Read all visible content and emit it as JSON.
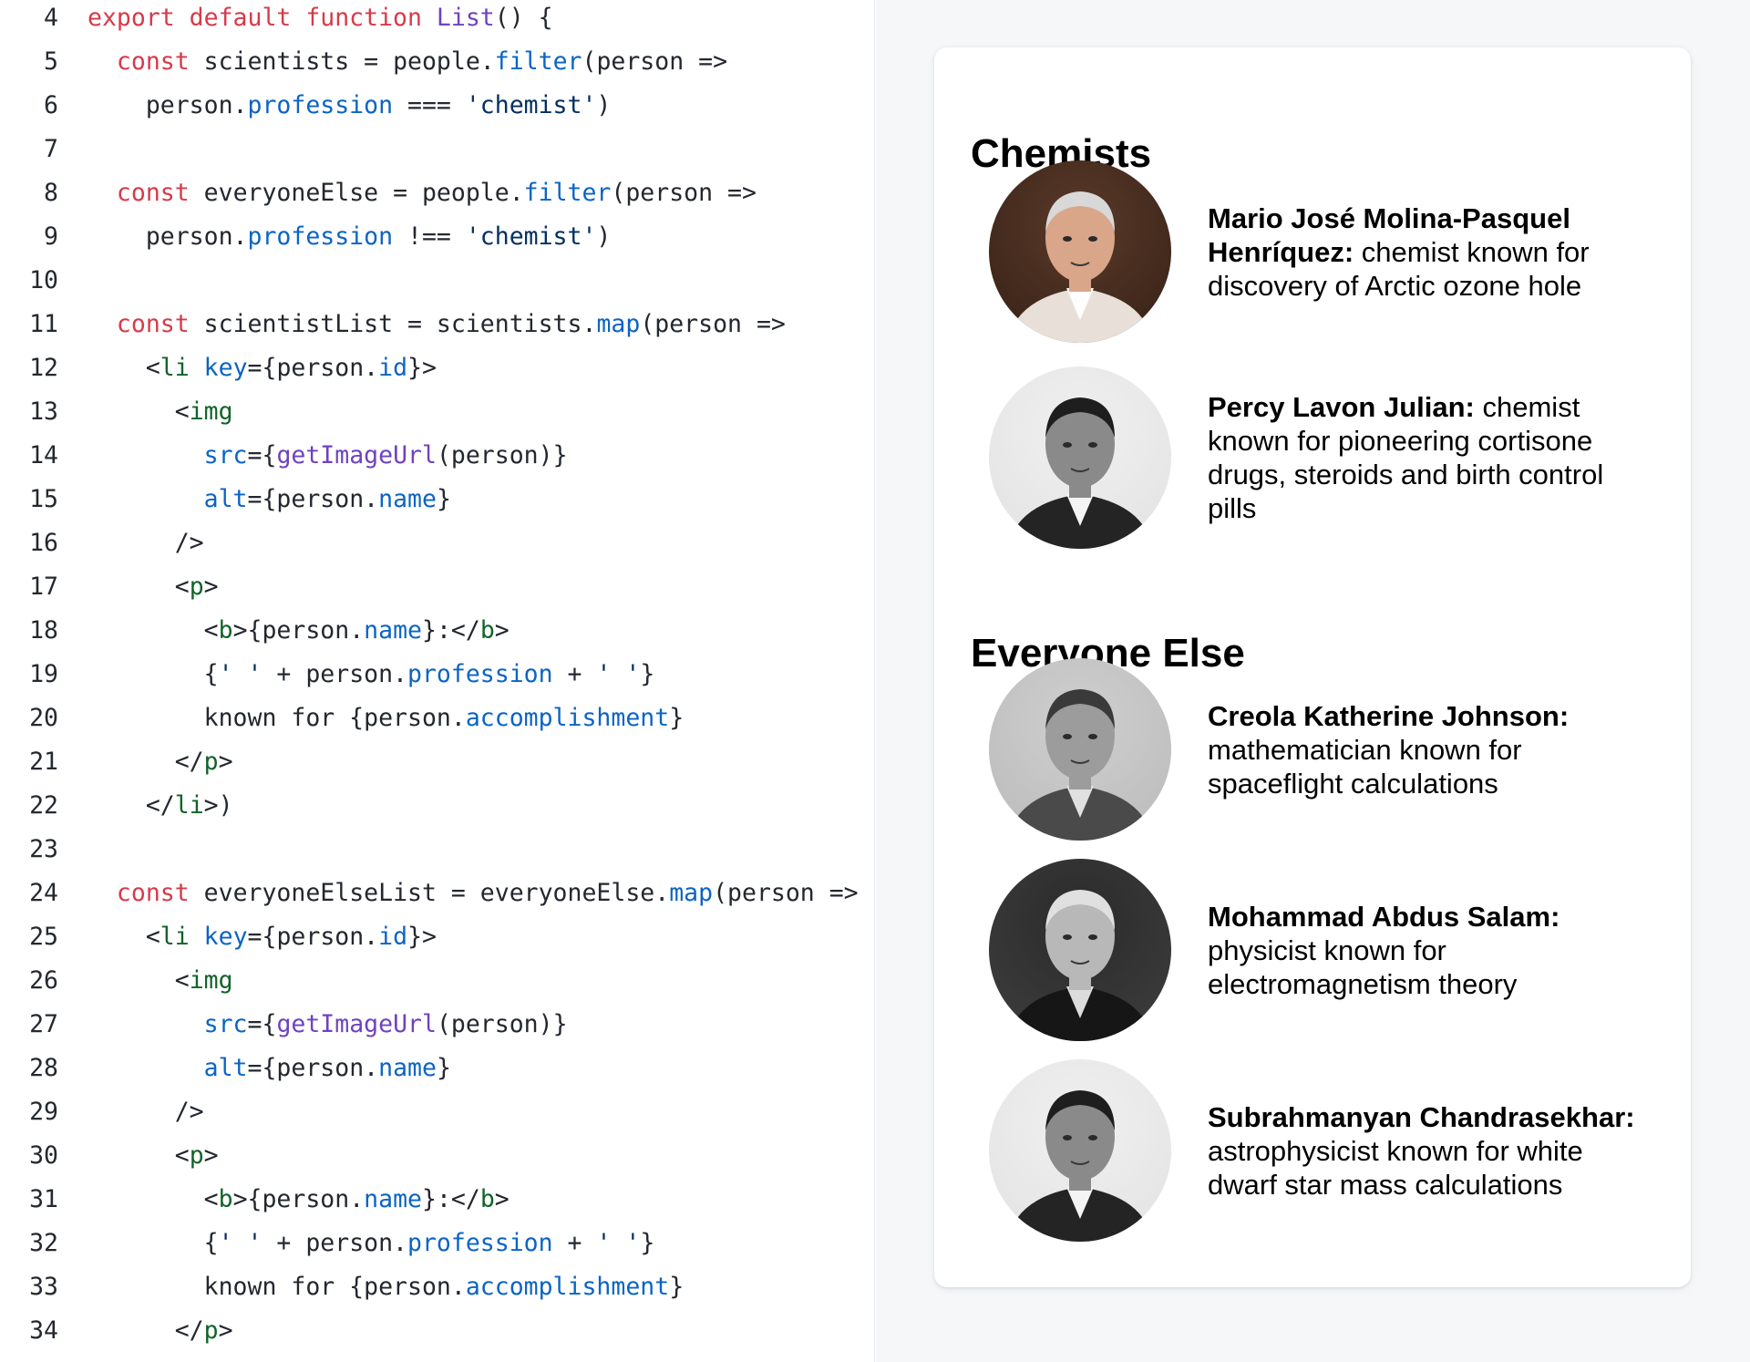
{
  "editor": {
    "lines": [
      {
        "n": "4",
        "segs": [
          [
            "k",
            "export default function "
          ],
          [
            "fn",
            "List"
          ],
          [
            "",
            "() {"
          ]
        ]
      },
      {
        "n": "5",
        "segs": [
          [
            "",
            "  "
          ],
          [
            "k",
            "const"
          ],
          [
            "",
            " scientists = people."
          ],
          [
            "pr",
            "filter"
          ],
          [
            "",
            "(person =>"
          ]
        ]
      },
      {
        "n": "6",
        "segs": [
          [
            "",
            "    person."
          ],
          [
            "pr",
            "profession"
          ],
          [
            "",
            " === "
          ],
          [
            "st",
            "'chemist'"
          ],
          [
            "",
            ")"
          ]
        ]
      },
      {
        "n": "7",
        "segs": [
          [
            "",
            ""
          ]
        ]
      },
      {
        "n": "8",
        "segs": [
          [
            "",
            "  "
          ],
          [
            "k",
            "const"
          ],
          [
            "",
            " everyoneElse = people."
          ],
          [
            "pr",
            "filter"
          ],
          [
            "",
            "(person =>"
          ]
        ]
      },
      {
        "n": "9",
        "segs": [
          [
            "",
            "    person."
          ],
          [
            "pr",
            "profession"
          ],
          [
            "",
            " !== "
          ],
          [
            "st",
            "'chemist'"
          ],
          [
            "",
            ")"
          ]
        ]
      },
      {
        "n": "10",
        "segs": [
          [
            "",
            ""
          ]
        ]
      },
      {
        "n": "11",
        "segs": [
          [
            "",
            "  "
          ],
          [
            "k",
            "const"
          ],
          [
            "",
            " scientistList = scientists."
          ],
          [
            "pr",
            "map"
          ],
          [
            "",
            "(person =>"
          ]
        ]
      },
      {
        "n": "12",
        "segs": [
          [
            "",
            "    <"
          ],
          [
            "tg",
            "li"
          ],
          [
            "",
            " "
          ],
          [
            "at",
            "key"
          ],
          [
            "",
            "={person."
          ],
          [
            "pr",
            "id"
          ],
          [
            "",
            "}>"
          ]
        ]
      },
      {
        "n": "13",
        "segs": [
          [
            "",
            "      <"
          ],
          [
            "tg",
            "img"
          ]
        ]
      },
      {
        "n": "14",
        "segs": [
          [
            "",
            "        "
          ],
          [
            "at",
            "src"
          ],
          [
            "",
            "={"
          ],
          [
            "fn",
            "getImageUrl"
          ],
          [
            "",
            "(person)}"
          ]
        ]
      },
      {
        "n": "15",
        "segs": [
          [
            "",
            "        "
          ],
          [
            "at",
            "alt"
          ],
          [
            "",
            "={person."
          ],
          [
            "pr",
            "name"
          ],
          [
            "",
            "}"
          ]
        ]
      },
      {
        "n": "16",
        "segs": [
          [
            "",
            "      />"
          ]
        ]
      },
      {
        "n": "17",
        "segs": [
          [
            "",
            "      <"
          ],
          [
            "tg",
            "p"
          ],
          [
            "",
            ">"
          ]
        ]
      },
      {
        "n": "18",
        "segs": [
          [
            "",
            "        <"
          ],
          [
            "tg",
            "b"
          ],
          [
            "",
            ">{person."
          ],
          [
            "pr",
            "name"
          ],
          [
            "",
            "}:</"
          ],
          [
            "tg",
            "b"
          ],
          [
            "",
            ">"
          ]
        ]
      },
      {
        "n": "19",
        "segs": [
          [
            "",
            "        {"
          ],
          [
            "st",
            "' '"
          ],
          [
            "",
            " + person."
          ],
          [
            "pr",
            "profession"
          ],
          [
            "",
            " + "
          ],
          [
            "st",
            "' '"
          ],
          [
            "",
            "}"
          ]
        ]
      },
      {
        "n": "20",
        "segs": [
          [
            "",
            "        known for {person."
          ],
          [
            "pr",
            "accomplishment"
          ],
          [
            "",
            "}"
          ]
        ]
      },
      {
        "n": "21",
        "segs": [
          [
            "",
            "      </"
          ],
          [
            "tg",
            "p"
          ],
          [
            "",
            ">"
          ]
        ]
      },
      {
        "n": "22",
        "segs": [
          [
            "",
            "    </"
          ],
          [
            "tg",
            "li"
          ],
          [
            "",
            ">)"
          ]
        ]
      },
      {
        "n": "23",
        "segs": [
          [
            "",
            ""
          ]
        ]
      },
      {
        "n": "24",
        "segs": [
          [
            "",
            "  "
          ],
          [
            "k",
            "const"
          ],
          [
            "",
            " everyoneElseList = everyoneElse."
          ],
          [
            "pr",
            "map"
          ],
          [
            "",
            "(person =>"
          ]
        ]
      },
      {
        "n": "25",
        "segs": [
          [
            "",
            "    <"
          ],
          [
            "tg",
            "li"
          ],
          [
            "",
            " "
          ],
          [
            "at",
            "key"
          ],
          [
            "",
            "={person."
          ],
          [
            "pr",
            "id"
          ],
          [
            "",
            "}>"
          ]
        ]
      },
      {
        "n": "26",
        "segs": [
          [
            "",
            "      <"
          ],
          [
            "tg",
            "img"
          ]
        ]
      },
      {
        "n": "27",
        "segs": [
          [
            "",
            "        "
          ],
          [
            "at",
            "src"
          ],
          [
            "",
            "={"
          ],
          [
            "fn",
            "getImageUrl"
          ],
          [
            "",
            "(person)}"
          ]
        ]
      },
      {
        "n": "28",
        "segs": [
          [
            "",
            "        "
          ],
          [
            "at",
            "alt"
          ],
          [
            "",
            "={person."
          ],
          [
            "pr",
            "name"
          ],
          [
            "",
            "}"
          ]
        ]
      },
      {
        "n": "29",
        "segs": [
          [
            "",
            "      />"
          ]
        ]
      },
      {
        "n": "30",
        "segs": [
          [
            "",
            "      <"
          ],
          [
            "tg",
            "p"
          ],
          [
            "",
            ">"
          ]
        ]
      },
      {
        "n": "31",
        "segs": [
          [
            "",
            "        <"
          ],
          [
            "tg",
            "b"
          ],
          [
            "",
            ">{person."
          ],
          [
            "pr",
            "name"
          ],
          [
            "",
            "}:</"
          ],
          [
            "tg",
            "b"
          ],
          [
            "",
            ">"
          ]
        ]
      },
      {
        "n": "32",
        "segs": [
          [
            "",
            "        {"
          ],
          [
            "st",
            "' '"
          ],
          [
            "",
            " + person."
          ],
          [
            "pr",
            "profession"
          ],
          [
            "",
            " + "
          ],
          [
            "st",
            "' '"
          ],
          [
            "",
            "}"
          ]
        ]
      },
      {
        "n": "33",
        "segs": [
          [
            "",
            "        known for {person."
          ],
          [
            "pr",
            "accomplishment"
          ],
          [
            "",
            "}"
          ]
        ]
      },
      {
        "n": "34",
        "segs": [
          [
            "",
            "      </"
          ],
          [
            "tg",
            "p"
          ],
          [
            "",
            ">"
          ]
        ]
      }
    ]
  },
  "preview": {
    "chemists_title": "Chemists",
    "everyone_else_title": "Everyone Else",
    "chemists": [
      {
        "name": "Mario José Molina-Pasquel Henríquez:",
        "desc": " chemist known for discovery of Arctic ozone hole",
        "tone": "color"
      },
      {
        "name": "Percy Lavon Julian:",
        "desc": " chemist known for pioneering cortisone drugs, steroids and birth control pills",
        "tone": "bw"
      }
    ],
    "everyone_else": [
      {
        "name": "Creola Katherine Johnson:",
        "desc": " mathematician known for spaceflight calculations",
        "tone": "bw-light"
      },
      {
        "name": "Mohammad Abdus Salam:",
        "desc": " physicist known for electromagnetism theory",
        "tone": "bw-dark"
      },
      {
        "name": "Subrahmanyan Chandrasekhar:",
        "desc": " astrophysicist known for white dwarf star mass calculations",
        "tone": "bw"
      }
    ]
  }
}
